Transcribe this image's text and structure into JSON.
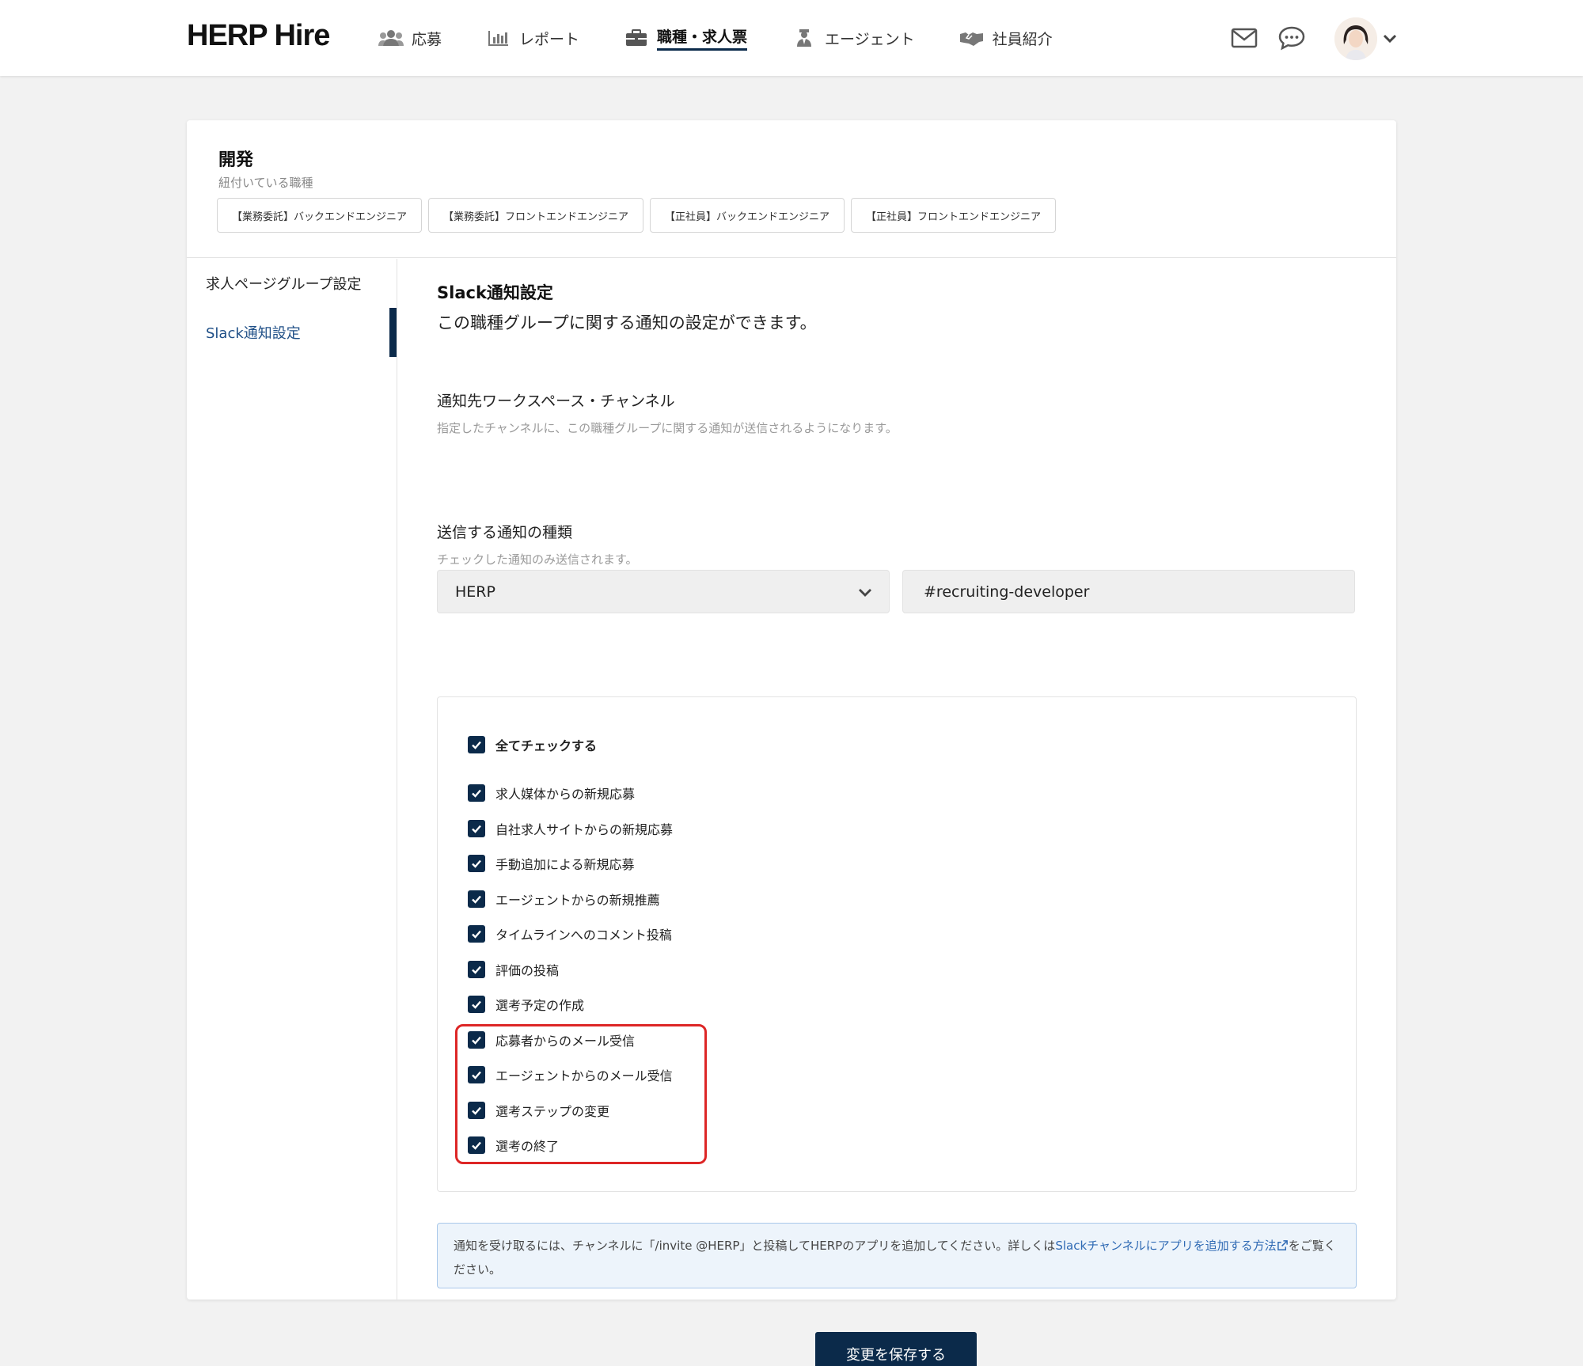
{
  "header": {
    "logo": "HERP Hire",
    "nav": [
      {
        "label": "応募",
        "icon": "users-icon",
        "active": false
      },
      {
        "label": "レポート",
        "icon": "chart-icon",
        "active": false
      },
      {
        "label": "職種・求人票",
        "icon": "briefcase-icon",
        "active": true
      },
      {
        "label": "エージェント",
        "icon": "agent-icon",
        "active": false
      },
      {
        "label": "社員紹介",
        "icon": "handshake-icon",
        "active": false
      }
    ]
  },
  "group": {
    "title": "開発",
    "linked_label": "紐付いている職種",
    "chips": [
      "【業務委託】バックエンドエンジニア",
      "【業務委託】フロントエンドエンジニア",
      "【正社員】バックエンドエンジニア",
      "【正社員】フロントエンドエンジニア"
    ]
  },
  "side_menu": [
    {
      "label": "求人ページグループ設定",
      "active": false
    },
    {
      "label": "Slack通知設定",
      "active": true
    }
  ],
  "slack": {
    "title": "Slack通知設定",
    "description": "この職種グループに関する通知の設定ができます。",
    "channel_label": "通知先ワークスペース・チャンネル",
    "channel_help": "指定したチャンネルに、この職種グループに関する通知が送信されるようになります。",
    "workspace_value": "HERP",
    "channel_value": "#recruiting-developer",
    "types_label": "送信する通知の種類",
    "types_help": "チェックした通知のみ送信されます。",
    "check_all": "全てチェックする",
    "checks": [
      "求人媒体からの新規応募",
      "自社求人サイトからの新規応募",
      "手動追加による新規応募",
      "エージェントからの新規推薦",
      "タイムラインへのコメント投稿",
      "評価の投稿",
      "選考予定の作成",
      "応募者からのメール受信",
      "エージェントからのメール受信",
      "選考ステップの変更",
      "選考の終了"
    ],
    "info_text_1": "通知を受け取るには、チャンネルに「/invite @HERP」と投稿してHERPのアプリを追加してください。詳しくは",
    "info_link": "Slackチャンネルにアプリを追加する方法",
    "info_text_2": "をご覧ください。",
    "save_label": "変更を保存する"
  },
  "colors": {
    "primary": "#0b2a4a",
    "link": "#2f6ab4",
    "highlight": "#dd2626",
    "info_bg": "#edf4fb"
  }
}
